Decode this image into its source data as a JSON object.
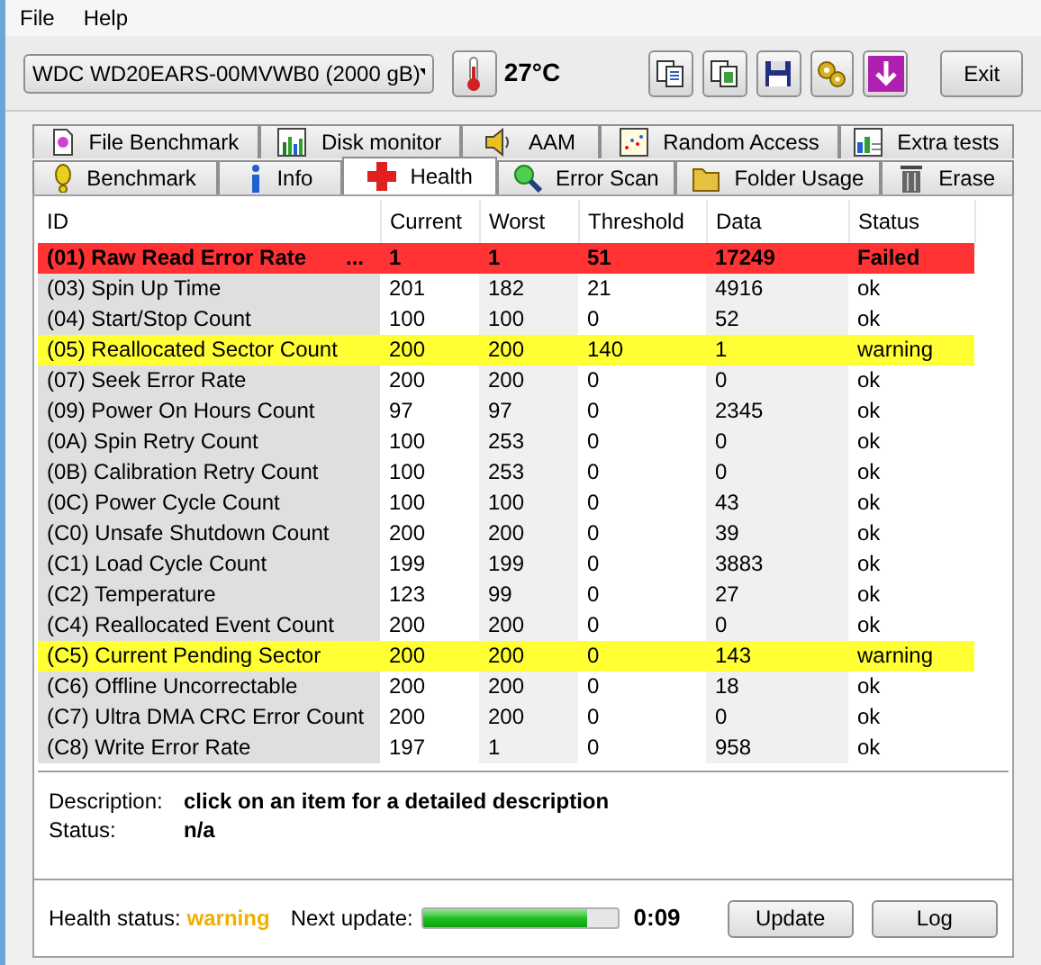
{
  "menu": [
    "File",
    "Help"
  ],
  "toolbar": {
    "drive": "WDC WD20EARS-00MVWB0 (2000 gB)",
    "temperature": "27°C",
    "exit": "Exit"
  },
  "tab_rows": [
    [
      {
        "label": "File Benchmark",
        "selected": false
      },
      {
        "label": "Disk monitor",
        "selected": false
      },
      {
        "label": "AAM",
        "selected": false
      },
      {
        "label": "Random Access",
        "selected": false
      },
      {
        "label": "Extra tests",
        "selected": false
      }
    ],
    [
      {
        "label": "Benchmark",
        "selected": false
      },
      {
        "label": "Info",
        "selected": false
      },
      {
        "label": "Health",
        "selected": true
      },
      {
        "label": "Error Scan",
        "selected": false
      },
      {
        "label": "Folder Usage",
        "selected": false
      },
      {
        "label": "Erase",
        "selected": false
      }
    ]
  ],
  "table": {
    "columns": [
      "ID",
      "Current",
      "Worst",
      "Threshold",
      "Data",
      "Status"
    ],
    "rows": [
      {
        "kind": "failed",
        "more": "...",
        "cells": [
          "(01) Raw Read Error Rate",
          "1",
          "1",
          "51",
          "17249",
          "Failed"
        ]
      },
      {
        "kind": "ok",
        "cells": [
          "(03) Spin Up Time",
          "201",
          "182",
          "21",
          "4916",
          "ok"
        ]
      },
      {
        "kind": "ok",
        "cells": [
          "(04) Start/Stop Count",
          "100",
          "100",
          "0",
          "52",
          "ok"
        ]
      },
      {
        "kind": "warning",
        "cells": [
          "(05) Reallocated Sector Count",
          "200",
          "200",
          "140",
          "1",
          "warning"
        ]
      },
      {
        "kind": "ok",
        "cells": [
          "(07) Seek Error Rate",
          "200",
          "200",
          "0",
          "0",
          "ok"
        ]
      },
      {
        "kind": "ok",
        "cells": [
          "(09) Power On Hours Count",
          "97",
          "97",
          "0",
          "2345",
          "ok"
        ]
      },
      {
        "kind": "ok",
        "cells": [
          "(0A) Spin Retry Count",
          "100",
          "253",
          "0",
          "0",
          "ok"
        ]
      },
      {
        "kind": "ok",
        "cells": [
          "(0B) Calibration Retry Count",
          "100",
          "253",
          "0",
          "0",
          "ok"
        ]
      },
      {
        "kind": "ok",
        "cells": [
          "(0C) Power Cycle Count",
          "100",
          "100",
          "0",
          "43",
          "ok"
        ]
      },
      {
        "kind": "ok",
        "cells": [
          "(C0) Unsafe Shutdown Count",
          "200",
          "200",
          "0",
          "39",
          "ok"
        ]
      },
      {
        "kind": "ok",
        "cells": [
          "(C1) Load Cycle Count",
          "199",
          "199",
          "0",
          "3883",
          "ok"
        ]
      },
      {
        "kind": "ok",
        "cells": [
          "(C2) Temperature",
          "123",
          "99",
          "0",
          "27",
          "ok"
        ]
      },
      {
        "kind": "ok",
        "cells": [
          "(C4) Reallocated Event Count",
          "200",
          "200",
          "0",
          "0",
          "ok"
        ]
      },
      {
        "kind": "warning",
        "cells": [
          "(C5) Current Pending Sector",
          "200",
          "200",
          "0",
          "143",
          "warning"
        ]
      },
      {
        "kind": "ok",
        "cells": [
          "(C6) Offline Uncorrectable",
          "200",
          "200",
          "0",
          "18",
          "ok"
        ]
      },
      {
        "kind": "ok",
        "cells": [
          "(C7) Ultra DMA CRC Error Count",
          "200",
          "200",
          "0",
          "0",
          "ok"
        ]
      },
      {
        "kind": "ok",
        "cells": [
          "(C8) Write Error Rate",
          "197",
          "1",
          "0",
          "958",
          "ok"
        ]
      }
    ]
  },
  "details": [
    {
      "label": "Description:",
      "value": "click on an item for a detailed description"
    },
    {
      "label": "Status:",
      "value": "n/a"
    }
  ],
  "footer": {
    "health_label": "Health status:",
    "health_value": "warning",
    "next_label": "Next update:",
    "level": 0.84,
    "time": "0:09",
    "buttons": [
      "Update",
      "Log"
    ]
  }
}
